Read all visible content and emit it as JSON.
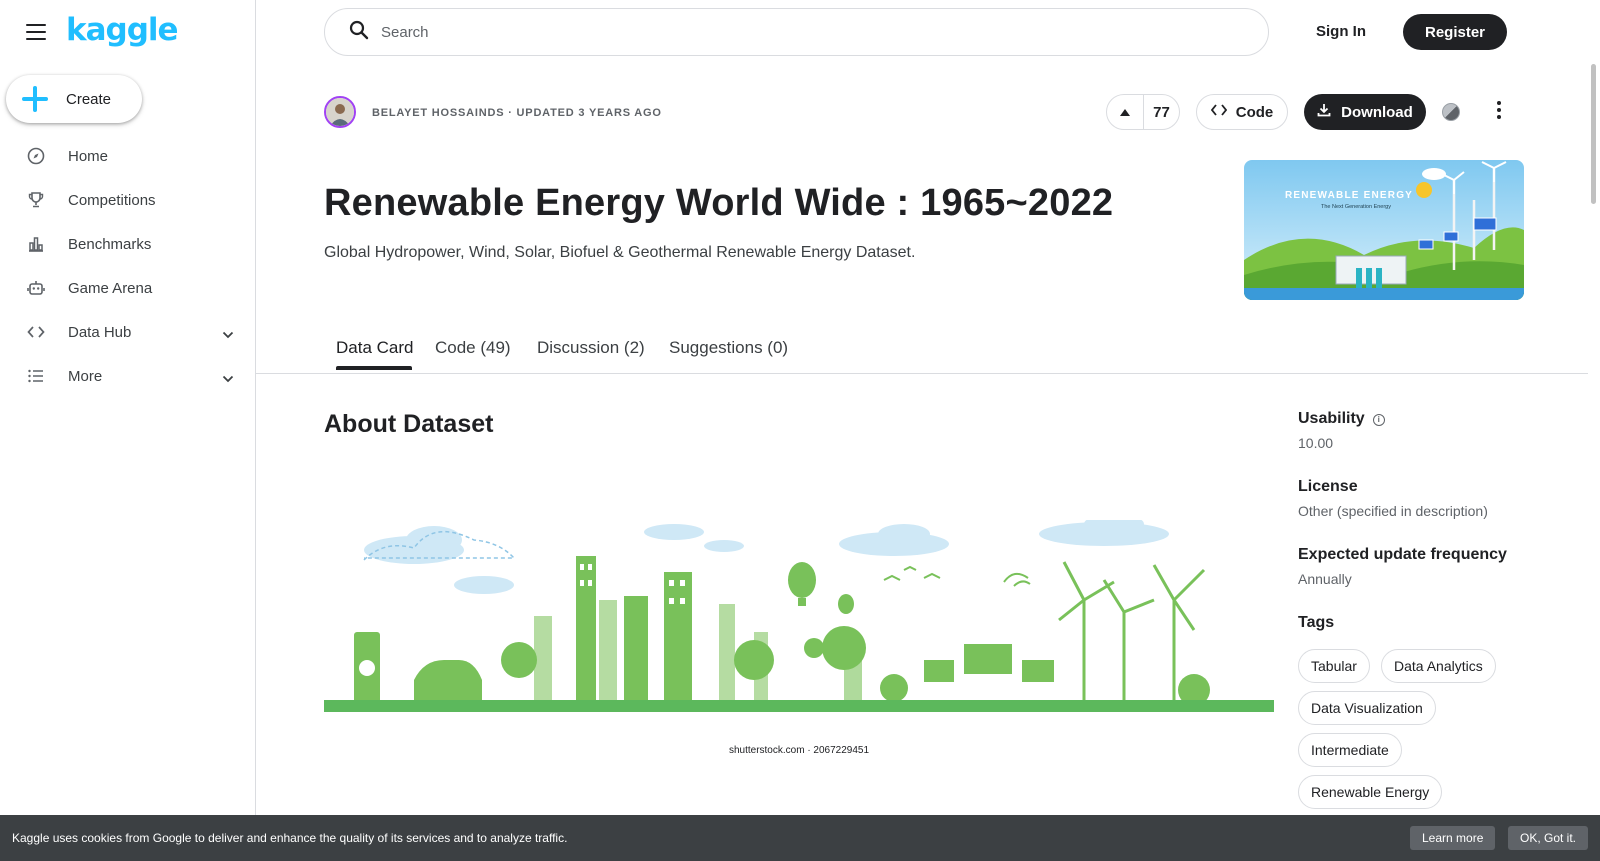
{
  "brand": {
    "logo": "kaggle",
    "accent": "#20beff"
  },
  "sidebar": {
    "create_label": "Create",
    "items": [
      {
        "label": "Home",
        "icon": "compass-icon"
      },
      {
        "label": "Competitions",
        "icon": "trophy-icon"
      },
      {
        "label": "Benchmarks",
        "icon": "bar-chart-icon"
      },
      {
        "label": "Game Arena",
        "icon": "robot-icon"
      },
      {
        "label": "Data Hub",
        "icon": "code-brackets-icon"
      },
      {
        "label": "More",
        "icon": "list-icon"
      }
    ]
  },
  "header": {
    "search_placeholder": "Search",
    "sign_in": "Sign In",
    "register": "Register"
  },
  "dataset": {
    "author_line": "BELAYET HOSSAINDS · UPDATED 3 YEARS AGO",
    "upvotes": "77",
    "code_label": "Code",
    "download_label": "Download",
    "title": "Renewable Energy World Wide : 1965~2022",
    "subtitle": "Global Hydropower, Wind, Solar, Biofuel & Geothermal Renewable Energy Dataset.",
    "cover_title": "RENEWABLE ENERGY",
    "cover_subtitle": "The Next Generation Energy"
  },
  "tabs": [
    {
      "label": "Data Card"
    },
    {
      "label": "Code (49)"
    },
    {
      "label": "Discussion (2)"
    },
    {
      "label": "Suggestions (0)"
    }
  ],
  "content": {
    "about_heading": "About Dataset",
    "image_caption": "shutterstock.com · 2067229451"
  },
  "meta": {
    "usability_label": "Usability",
    "usability_value": "10.00",
    "license_label": "License",
    "license_value": "Other (specified in description)",
    "frequency_label": "Expected update frequency",
    "frequency_value": "Annually",
    "tags_label": "Tags",
    "tags": [
      "Tabular",
      "Data Analytics",
      "Data Visualization",
      "Intermediate",
      "Renewable Energy"
    ]
  },
  "cookie": {
    "text": "Kaggle uses cookies from Google to deliver and enhance the quality of its services and to analyze traffic.",
    "learn_more": "Learn more",
    "ok": "OK, Got it."
  }
}
